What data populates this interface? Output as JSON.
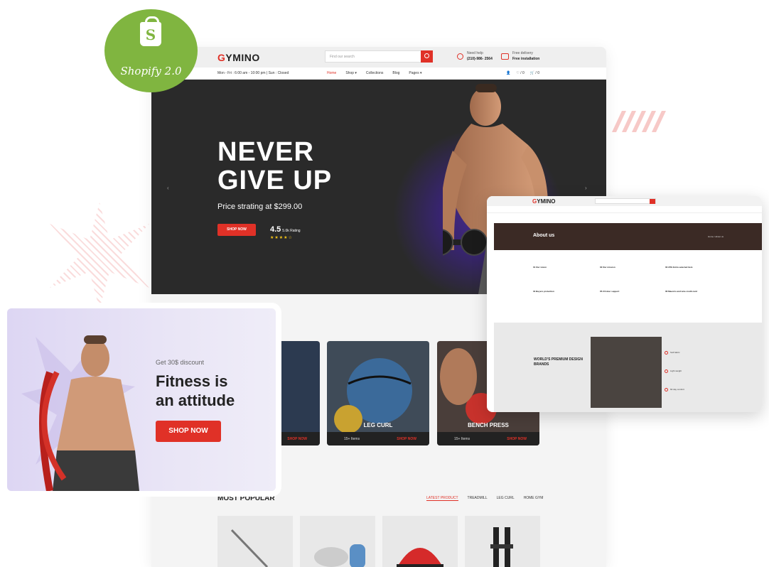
{
  "badge": {
    "label": "Shopify 2.0",
    "bag_letter": "S"
  },
  "site": {
    "logo": {
      "mark": "G",
      "rest": "YMINO"
    },
    "search": {
      "placeholder": "Find our search"
    },
    "help": {
      "label": "Need help",
      "phone": "(210)-986- 2564"
    },
    "delivery": {
      "label": "Free delivery",
      "sub": "Free installation"
    },
    "hours": "Mon - Fri : 6:00 am - 10:00 pm | Sun : Closed",
    "nav": [
      {
        "label": "Home",
        "active": true
      },
      {
        "label": "Shop ▾"
      },
      {
        "label": "Collections"
      },
      {
        "label": "Blog"
      },
      {
        "label": "Pages ▾"
      }
    ],
    "nav_icons": {
      "wishlist": "♡ / 0",
      "cart": "🛒 / 0"
    },
    "hero": {
      "line1": "NEVER",
      "line2": "GIVE UP",
      "price": "Price strating at $299.00",
      "button": "SHOP NOW",
      "rating": "4.5",
      "rating_label": "5.0k Rating",
      "stars": "★★★★☆"
    },
    "categories": [
      {
        "label": "…KE",
        "items": "",
        "cta": "SHOP NOW"
      },
      {
        "label": "LEG CURL",
        "items": "15+ Items",
        "cta": "SHOP NOW"
      },
      {
        "label": "BENCH PRESS",
        "items": "15+ Items",
        "cta": "SHOP NOW"
      }
    ],
    "popular": {
      "title": "MOST POPULAR",
      "tabs": [
        "LATEST PRODUCT",
        "TREADMILL",
        "LEG CURL",
        "HOME GYM"
      ]
    }
  },
  "promo": {
    "discount": "Get 30$ discount",
    "line1": "Fitness is",
    "line2": "an attitude",
    "button": "SHOP NOW"
  },
  "about": {
    "logo": {
      "mark": "G",
      "rest": "YMINO"
    },
    "title": "About us",
    "breadcrumb": "Home / about us",
    "columns": [
      {
        "h1": "01 Our vision",
        "h2": "04 Buyers protection"
      },
      {
        "h1": "02 Our mission",
        "h2": "05 24 Hour support"
      },
      {
        "h1": "03 20% Extra selected item",
        "h2": "06 Maestro and wire credit card"
      }
    ],
    "brands_title": "WORLD'S PREMIUM DESIGN BRANDS",
    "features": [
      "Soft fabric",
      "Light weight",
      "60 day comfort"
    ]
  },
  "colors": {
    "accent": "#e03127",
    "shopify": "#80b540",
    "hero_bg": "#2a2a2a"
  }
}
